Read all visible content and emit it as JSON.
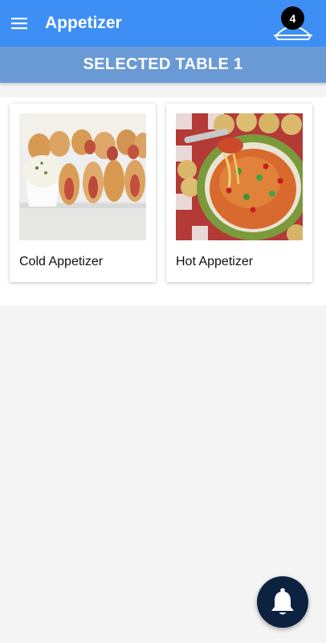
{
  "app_bar": {
    "title": "Appetizer",
    "menu_icon": "hamburger-menu-icon",
    "cart": {
      "icon": "food-tray-icon",
      "count": "4"
    }
  },
  "banner": {
    "text": "SELECTED TABLE 1"
  },
  "categories": [
    {
      "label": "Cold Appetizer",
      "image": "pigs-in-blanket-with-dip-photo"
    },
    {
      "label": "Hot Appetizer",
      "image": "hot-cheesy-dip-with-crackers-photo"
    }
  ],
  "fab": {
    "icon": "bell-icon"
  },
  "colors": {
    "app_bar": "#3d8ef5",
    "banner": "#6a9ad6",
    "fab": "#0d2240",
    "background": "#f4f4f4"
  }
}
